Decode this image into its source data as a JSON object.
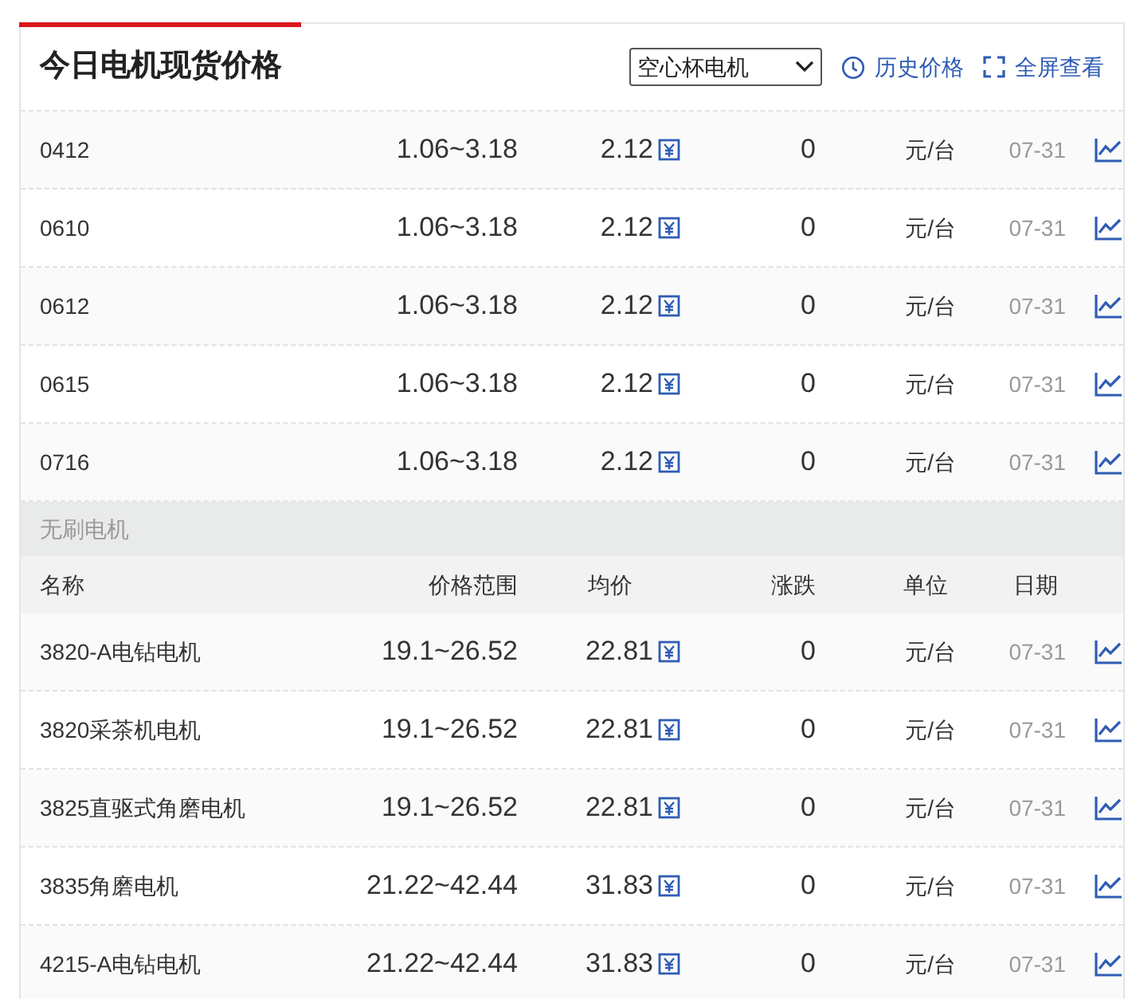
{
  "title": "今日电机现货价格",
  "category_select": {
    "value": "空心杯电机"
  },
  "actions": [
    {
      "kind": "history",
      "label": "历史价格"
    },
    {
      "kind": "fullscreen",
      "label": "全屏查看"
    }
  ],
  "sections": [
    {
      "rows": [
        {
          "name": "0412",
          "range": "1.06~3.18",
          "avg": "2.12",
          "change": "0",
          "unit": "元/台",
          "date": "07-31"
        },
        {
          "name": "0610",
          "range": "1.06~3.18",
          "avg": "2.12",
          "change": "0",
          "unit": "元/台",
          "date": "07-31"
        },
        {
          "name": "0612",
          "range": "1.06~3.18",
          "avg": "2.12",
          "change": "0",
          "unit": "元/台",
          "date": "07-31"
        },
        {
          "name": "0615",
          "range": "1.06~3.18",
          "avg": "2.12",
          "change": "0",
          "unit": "元/台",
          "date": "07-31"
        },
        {
          "name": "0716",
          "range": "1.06~3.18",
          "avg": "2.12",
          "change": "0",
          "unit": "元/台",
          "date": "07-31"
        }
      ]
    },
    {
      "heading": "无刷电机",
      "columns": [
        "名称",
        "价格范围",
        "均价",
        "涨跌",
        "单位",
        "日期"
      ],
      "rows": [
        {
          "name": "3820-A电钻电机",
          "range": "19.1~26.52",
          "avg": "22.81",
          "change": "0",
          "unit": "元/台",
          "date": "07-31"
        },
        {
          "name": "3820采茶机电机",
          "range": "19.1~26.52",
          "avg": "22.81",
          "change": "0",
          "unit": "元/台",
          "date": "07-31"
        },
        {
          "name": "3825直驱式角磨电机",
          "range": "19.1~26.52",
          "avg": "22.81",
          "change": "0",
          "unit": "元/台",
          "date": "07-31"
        },
        {
          "name": "3835角磨电机",
          "range": "21.22~42.44",
          "avg": "31.83",
          "change": "0",
          "unit": "元/台",
          "date": "07-31"
        },
        {
          "name": "4215-A电钻电机",
          "range": "21.22~42.44",
          "avg": "31.83",
          "change": "0",
          "unit": "元/台",
          "date": "07-31"
        }
      ]
    }
  ]
}
